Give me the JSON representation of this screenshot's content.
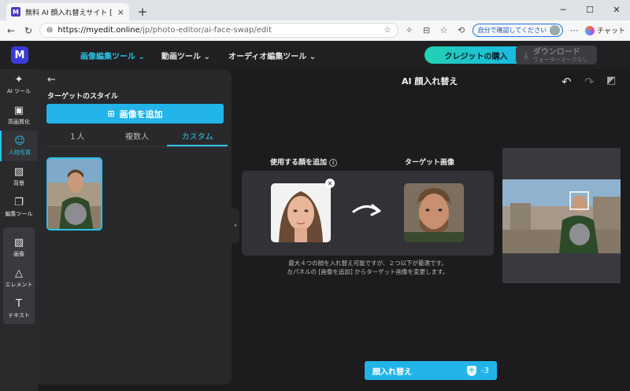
{
  "browser": {
    "tab_title": "無料 AI 顔入れ替えサイト [写真同士",
    "tab_close": "×",
    "new_tab": "+",
    "url_host": "https://myedit.online",
    "url_path": "/jp/photo-editor/ai-face-swap/edit",
    "verify_label": "自分で確認してください",
    "chat_label": "チャット",
    "win_min": "─",
    "win_max": "☐",
    "win_close": "✕"
  },
  "app": {
    "logo": "M",
    "menus": [
      "画像編集ツール ⌄",
      "動画ツール ⌄",
      "オーディオ編集ツール ⌄"
    ],
    "credit_button": "クレジットの購入",
    "download_label": "ダウンロード",
    "download_sub": "ウォーターマークなし"
  },
  "toolbar": {
    "items": [
      {
        "icon": "magic-wand-icon",
        "glyph": "⁄",
        "label": "AI ツール"
      },
      {
        "icon": "enhance-icon",
        "glyph": "▣",
        "label": "高画質化"
      },
      {
        "icon": "portrait-icon",
        "glyph": "☺",
        "label": "人物写真"
      },
      {
        "icon": "background-icon",
        "glyph": "▨",
        "label": "背景"
      },
      {
        "icon": "edit-tools-icon",
        "glyph": "❐",
        "label": "編集ツール"
      }
    ],
    "group": [
      {
        "icon": "image-icon",
        "glyph": "▨",
        "label": "画像"
      },
      {
        "icon": "elements-icon",
        "glyph": "△",
        "label": "エレメント"
      },
      {
        "icon": "text-icon",
        "glyph": "T",
        "label": "テキスト"
      }
    ]
  },
  "panel": {
    "back": "←",
    "title": "ターゲットのスタイル",
    "add_image": "画像を追加",
    "tabs": [
      "１人",
      "複数人",
      "カスタム"
    ],
    "active_tab": 2
  },
  "main": {
    "title": "AI 顔入れ替え",
    "face_label": "使用する顔を追加",
    "info": "i",
    "target_label": "ターゲット画像",
    "note_line1": "最大４つの顔を入れ替え可能ですが、２つ以下が最適です。",
    "note_line2": "左パネルの [画像を追加] からターゲット画像を変更します。",
    "swap_button": "顔入れ替え",
    "swap_cost": "-3",
    "collapse": "‹"
  },
  "colors": {
    "accent": "#22b4e8",
    "credit_gradient_start": "#22d1b2",
    "background": "#1c1c1e"
  }
}
